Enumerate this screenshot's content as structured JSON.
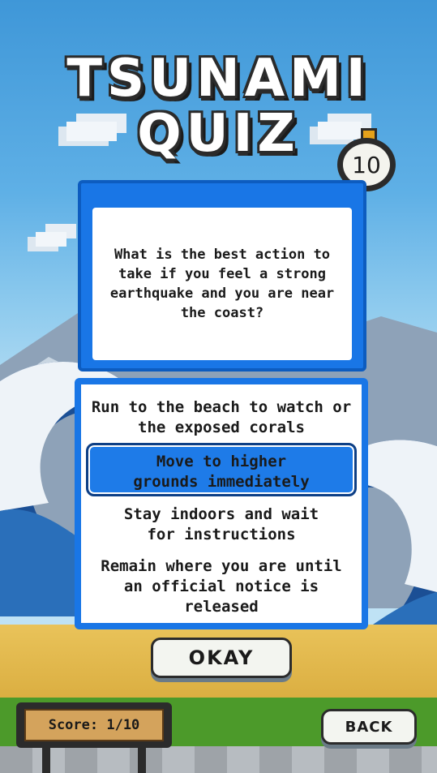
{
  "title": {
    "line1": "TSUNAMI",
    "line2": "QUIZ"
  },
  "timer": {
    "value": "10"
  },
  "question": {
    "text": "What is the best action to take if you feel a strong earthquake and you are near the coast?"
  },
  "answers": [
    {
      "label": "Run to the beach to watch or the exposed corals",
      "selected": false
    },
    {
      "label": "Move to higher grounds immediately",
      "selected": true
    },
    {
      "label": "Stay indoors and wait for instructions",
      "selected": false
    },
    {
      "label": "Remain where you are until an official notice is released",
      "selected": false
    }
  ],
  "buttons": {
    "okay": "OKAY",
    "back": "BACK"
  },
  "score": {
    "label": "Score: 1/10"
  },
  "colors": {
    "accent": "#1976e6",
    "selected": "#1e7be8",
    "scorePanel": "#d4a35c",
    "timerKnob": "#e5a21b"
  },
  "icons": {
    "timer": "stopwatch-icon"
  }
}
